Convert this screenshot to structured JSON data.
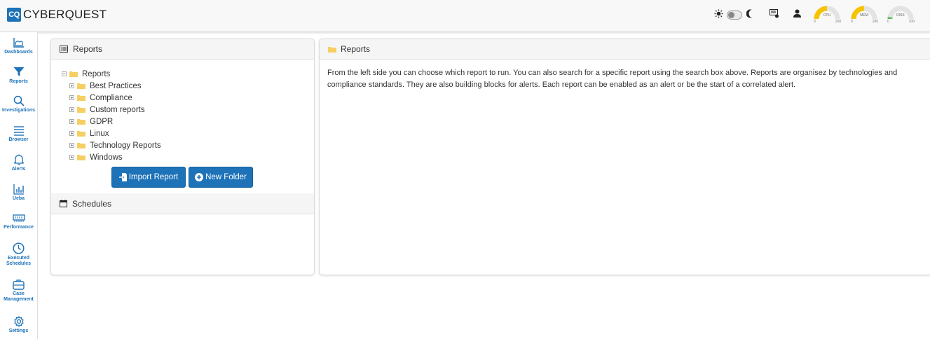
{
  "brand": {
    "badge": "CQ",
    "name": "CYBERQUEST"
  },
  "header": {
    "icons": [
      "sun-icon",
      "theme-toggle",
      "moon-icon",
      "notifications-icon",
      "user-icon"
    ],
    "gauges": [
      {
        "label": "CPU",
        "min": "0",
        "max": "100",
        "color": "#f5c400",
        "value_fraction": 0.5
      },
      {
        "label": "MEM",
        "min": "0",
        "max": "100",
        "color": "#f5c400",
        "value_fraction": 0.5
      },
      {
        "label": "DISK",
        "min": "0",
        "max": "100",
        "color": "#5cb85c",
        "value_fraction": 0.05
      }
    ]
  },
  "sidebar": {
    "items": [
      {
        "label": "Dashboards",
        "icon": "chart-area-icon"
      },
      {
        "label": "Reports",
        "icon": "filter-icon"
      },
      {
        "label": "Investigations",
        "icon": "search-icon"
      },
      {
        "label": "Browser",
        "icon": "lines-icon"
      },
      {
        "label": "Alerts",
        "icon": "bell-icon"
      },
      {
        "label": "Ueba",
        "icon": "bar-chart-icon"
      },
      {
        "label": "Performance",
        "icon": "memory-icon"
      },
      {
        "label": "Executed",
        "label2": "Schedules",
        "icon": "clock-icon"
      },
      {
        "label": "Case",
        "label2": "Management",
        "icon": "briefcase-icon"
      },
      {
        "label": "Settings",
        "icon": "gear-icon"
      }
    ]
  },
  "left_panel": {
    "title": "Reports",
    "tree": {
      "root": "Reports",
      "children": [
        "Best Practices",
        "Compliance",
        "Custom reports",
        "GDPR",
        "Linux",
        "Technology Reports",
        "Windows"
      ]
    },
    "import_button": "Import Report",
    "new_folder_button": "New Folder",
    "schedules_title": "Schedules"
  },
  "right_panel": {
    "title": "Reports",
    "description": "From the left side you can choose which report to run. You can also search for a specific report using the search box above. Reports are organisez by technologies and compliance standards. They are also building blocks for alerts. Each report can be enabled as an alert or be the start of a correlated alert."
  },
  "colors": {
    "accent": "#1d72b8",
    "folder": "#f6cf63",
    "gauge_warn": "#f5c400",
    "gauge_ok": "#5cb85c"
  }
}
